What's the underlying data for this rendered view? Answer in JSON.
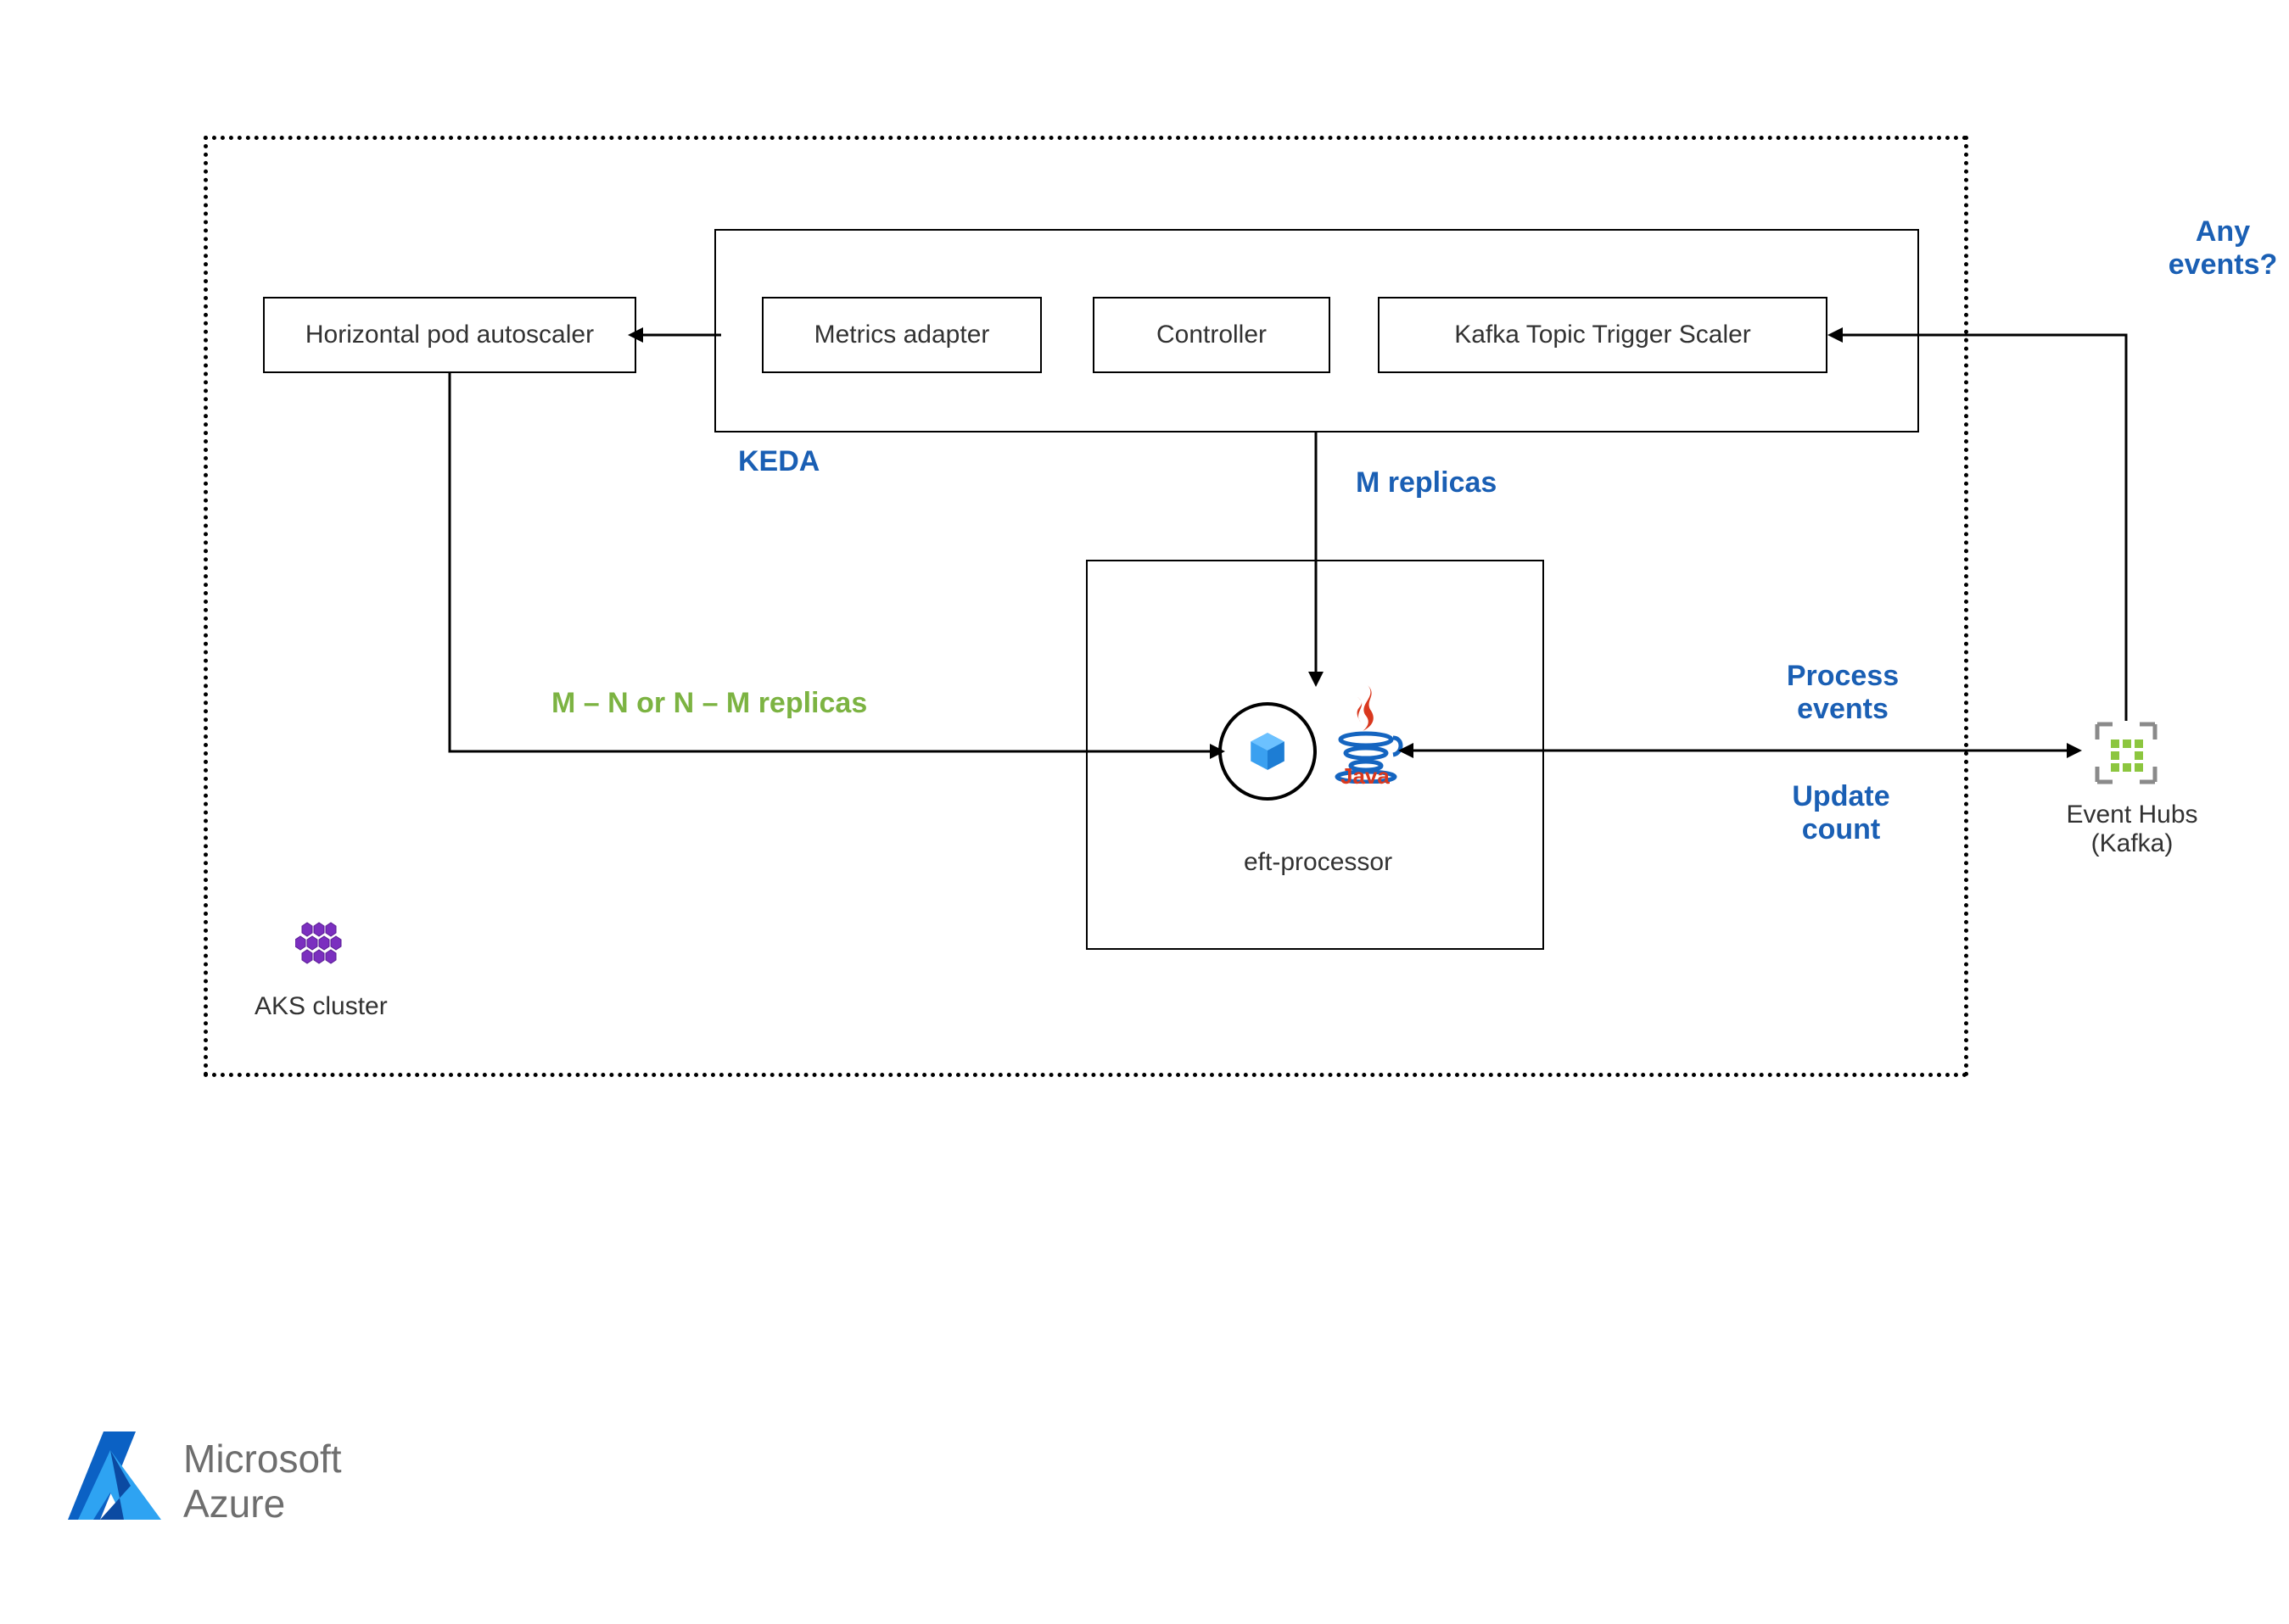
{
  "diagram": {
    "aks_cluster_label": "AKS cluster",
    "hpa_label": "Horizontal pod autoscaler",
    "keda": {
      "title": "KEDA",
      "metrics_adapter": "Metrics adapter",
      "controller": "Controller",
      "scaler": "Kafka Topic Trigger Scaler"
    },
    "m_replicas": "M replicas",
    "hpa_replicas": "M – N or N – M replicas",
    "eft_processor": "eft-processor",
    "process_events": "Process events",
    "update_count": "Update count",
    "any_events": "Any events?",
    "event_hubs_line1": "Event Hubs",
    "event_hubs_line2": "(Kafka)"
  },
  "footer": {
    "brand1": "Microsoft",
    "brand2": "Azure"
  }
}
